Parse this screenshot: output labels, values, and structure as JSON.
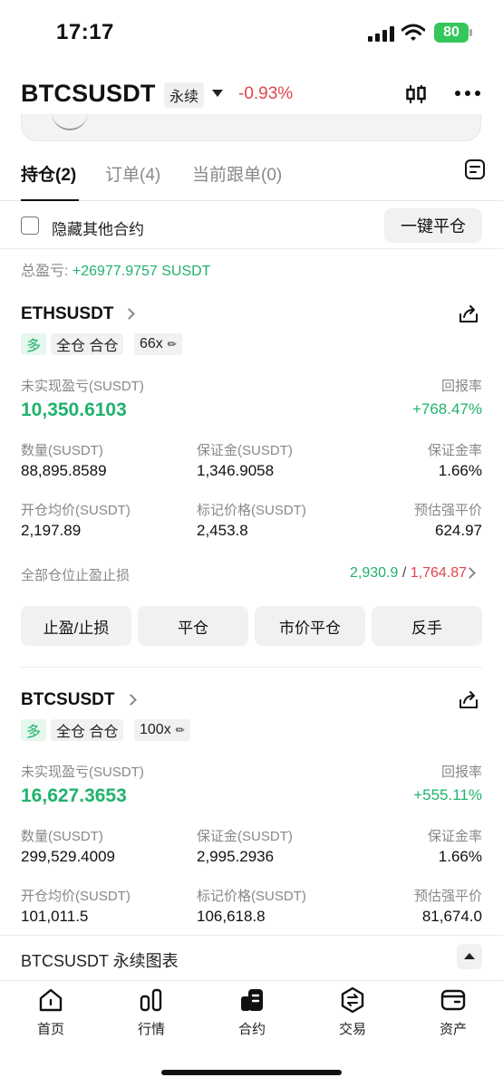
{
  "status": {
    "time": "17:17",
    "battery": "80"
  },
  "header": {
    "symbol": "BTCSUSDT",
    "badge": "永续",
    "change": "-0.93%"
  },
  "tabs": [
    {
      "label": "持仓(2)",
      "active": true
    },
    {
      "label": "订单(4)",
      "active": false
    },
    {
      "label": "当前跟单(0)",
      "active": false
    }
  ],
  "hide_other": {
    "label": "隐藏其他合约"
  },
  "close_all": {
    "label": "一键平仓"
  },
  "total_pnl": {
    "label": "总盈亏: ",
    "value": "+26977.9757 SUSDT"
  },
  "positions": [
    {
      "symbol": "ETHSUSDT",
      "side": "多",
      "margin_mode": "全仓 合仓",
      "leverage": "66x",
      "unrealized_label": "未实现盈亏(SUSDT)",
      "unrealized_value": "10,350.6103",
      "roi_label": "回报率",
      "roi_value": "+768.47%",
      "qty_label": "数量(SUSDT)",
      "qty_value": "88,895.8589",
      "margin_label": "保证金(SUSDT)",
      "margin_value": "1,346.9058",
      "margin_rate_label": "保证金率",
      "margin_rate_value": "1.66%",
      "entry_label": "开仓均价(SUSDT)",
      "entry_value": "2,197.89",
      "mark_label": "标记价格(SUSDT)",
      "mark_value": "2,453.8",
      "liq_label": "预估强平价",
      "liq_value": "624.97",
      "tpsl_label": "全部仓位止盈止损",
      "tp_value": "2,930.9",
      "sl_value": "1,764.87",
      "actions": [
        "止盈/止损",
        "平仓",
        "市价平仓",
        "反手"
      ]
    },
    {
      "symbol": "BTCSUSDT",
      "side": "多",
      "margin_mode": "全仓 合仓",
      "leverage": "100x",
      "unrealized_label": "未实现盈亏(SUSDT)",
      "unrealized_value": "16,627.3653",
      "roi_label": "回报率",
      "roi_value": "+555.11%",
      "qty_label": "数量(SUSDT)",
      "qty_value": "299,529.4009",
      "margin_label": "保证金(SUSDT)",
      "margin_value": "2,995.2936",
      "margin_rate_label": "保证金率",
      "margin_rate_value": "1.66%",
      "entry_label": "开仓均价(SUSDT)",
      "entry_value": "101,011.5",
      "mark_label": "标记价格(SUSDT)",
      "mark_value": "106,618.8",
      "liq_label": "预估强平价",
      "liq_value": "81,674.0"
    }
  ],
  "chart_bar": {
    "label": "BTCSUSDT 永续图表"
  },
  "nav": [
    {
      "label": "首页",
      "icon": "home-icon"
    },
    {
      "label": "行情",
      "icon": "markets-icon"
    },
    {
      "label": "合约",
      "icon": "futures-icon",
      "active": true
    },
    {
      "label": "交易",
      "icon": "trade-icon"
    },
    {
      "label": "资产",
      "icon": "wallet-icon"
    }
  ],
  "colors": {
    "up": "#20b26c",
    "down": "#e0454c",
    "battery": "#34c759"
  }
}
